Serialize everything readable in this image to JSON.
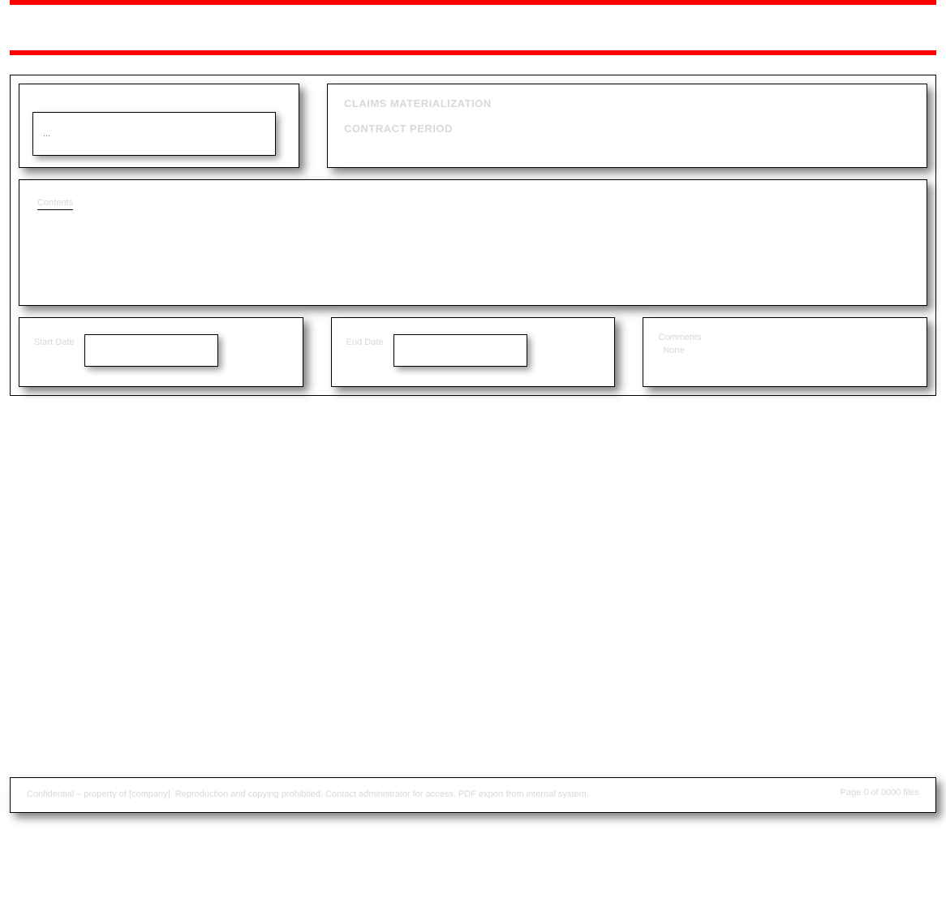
{
  "search": {
    "placeholder": "..."
  },
  "title": {
    "line1": "CLAIMS MATERIALIZATION",
    "line2": "CONTRACT PERIOD"
  },
  "content": {
    "heading": "Contents"
  },
  "date_from": {
    "label": "Start Date"
  },
  "date_to": {
    "label": "End Date"
  },
  "status": {
    "label": "Comments",
    "value": "None"
  },
  "footer": {
    "left": "Confidential – property of [company]. Reproduction and copying prohibited. Contact administrator for access. PDF export from internal system.",
    "right": "Page 0 of 0000 files"
  }
}
